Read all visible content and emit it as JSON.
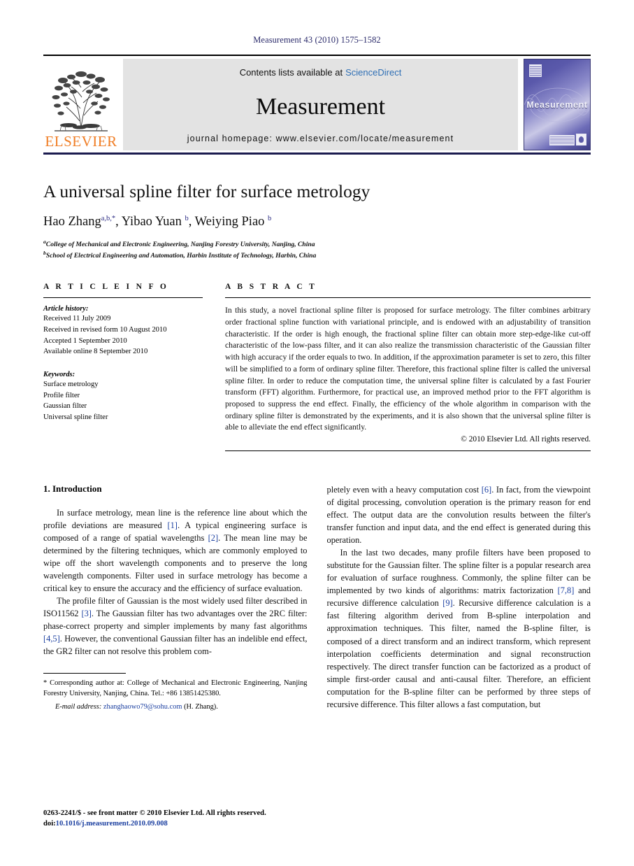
{
  "running_head": "Measurement 43 (2010) 1575–1582",
  "masthead": {
    "publisher_name": "ELSEVIER",
    "contents_prefix": "Contents lists available at",
    "sciencedirect": "ScienceDirect",
    "journal_title": "Measurement",
    "homepage": "journal homepage: www.elsevier.com/locate/measurement",
    "cover_word": "Measurement"
  },
  "article": {
    "title": "A universal spline filter for surface metrology",
    "authors": [
      {
        "name": "Hao Zhang",
        "sup": "a,b,*"
      },
      {
        "name": "Yibao Yuan",
        "sup": "b"
      },
      {
        "name": "Weiying Piao",
        "sup": "b"
      }
    ],
    "authors_line": "Hao Zhang a,b,*, Yibao Yuan b, Weiying Piao b",
    "affiliations": [
      {
        "marker": "a",
        "text": "College of Mechanical and Electronic Engineering, Nanjing Forestry University, Nanjing, China"
      },
      {
        "marker": "b",
        "text": "School of Electrical Engineering and Automation, Harbin Institute of Technology, Harbin, China"
      }
    ]
  },
  "article_info": {
    "heading": "A R T I C L E  I N F O",
    "history_label": "Article history:",
    "history": [
      "Received 11 July 2009",
      "Received in revised form 10 August 2010",
      "Accepted 1 September 2010",
      "Available online 8 September 2010"
    ],
    "keywords_label": "Keywords:",
    "keywords": [
      "Surface metrology",
      "Profile filter",
      "Gaussian filter",
      "Universal spline filter"
    ]
  },
  "abstract": {
    "heading": "A B S T R A C T",
    "text": "In this study, a novel fractional spline filter is proposed for surface metrology. The filter combines arbitrary order fractional spline function with variational principle, and is endowed with an adjustability of transition characteristic. If the order is high enough, the fractional spline filter can obtain more step-edge-like cut-off characteristic of the low-pass filter, and it can also realize the transmission characteristic of the Gaussian filter with high accuracy if the order equals to two. In addition, if the approximation parameter is set to zero, this filter will be simplified to a form of ordinary spline filter. Therefore, this fractional spline filter is called the universal spline filter. In order to reduce the computation time, the universal spline filter is calculated by a fast Fourier transform (FFT) algorithm. Furthermore, for practical use, an improved method prior to the FFT algorithm is proposed to suppress the end effect. Finally, the efficiency of the whole algorithm in comparison with the ordinary spline filter is demonstrated by the experiments, and it is also shown that the universal spline filter is able to alleviate the end effect significantly.",
    "copyright": "© 2010 Elsevier Ltd. All rights reserved."
  },
  "body": {
    "section_heading": "1. Introduction",
    "left_paragraphs": [
      "In surface metrology, mean line is the reference line about which the profile deviations are measured [1]. A typical engineering surface is composed of a range of spatial wavelengths [2]. The mean line may be determined by the filtering techniques, which are commonly employed to wipe off the short wavelength components and to preserve the long wavelength components. Filter used in surface metrology has become a critical key to ensure the accuracy and the efficiency of surface evaluation.",
      "The profile filter of Gaussian is the most widely used filter described in ISO11562 [3]. The Gaussian filter has two advantages over the 2RC filter: phase-correct property and simpler implements by many fast algorithms [4,5]. However, the conventional Gaussian filter has an indelible end effect, the GR2 filter can not resolve this problem com-"
    ],
    "right_paragraphs": [
      "pletely even with a heavy computation cost [6]. In fact, from the viewpoint of digital processing, convolution operation is the primary reason for end effect. The output data are the convolution results between the filter's transfer function and input data, and the end effect is generated during this operation.",
      "In the last two decades, many profile filters have been proposed to substitute for the Gaussian filter. The spline filter is a popular research area for evaluation of surface roughness. Commonly, the spline filter can be implemented by two kinds of algorithms: matrix factorization [7,8] and recursive difference calculation [9]. Recursive difference calculation is a fast filtering algorithm derived from B-spline interpolation and approximation techniques. This filter, named the B-spline filter, is composed of a direct transform and an indirect transform, which represent interpolation coefficients determination and signal reconstruction respectively. The direct transfer function can be factorized as a product of simple first-order causal and anti-causal filter. Therefore, an efficient computation for the B-spline filter can be performed by three steps of recursive difference. This filter allows a fast computation, but"
    ]
  },
  "footnotes": {
    "corresponding": "* Corresponding author at: College of Mechanical and Electronic Engineering, Nanjing Forestry University, Nanjing, China. Tel.: +86 13851425380.",
    "email_label": "E-mail address:",
    "email": "zhanghaowo79@sohu.com",
    "email_suffix": "(H. Zhang)."
  },
  "imprint": {
    "issn_line": "0263-2241/$ - see front matter © 2010 Elsevier Ltd. All rights reserved.",
    "doi_prefix": "doi:",
    "doi": "10.1016/j.measurement.2010.09.008"
  },
  "colors": {
    "link_blue": "#1b3fa0",
    "sciencedirect_blue": "#2f6fb5",
    "elsevier_orange": "#f07e26",
    "running_head_navy": "#2a2a6a",
    "cover_purple": "#5a59ab"
  }
}
